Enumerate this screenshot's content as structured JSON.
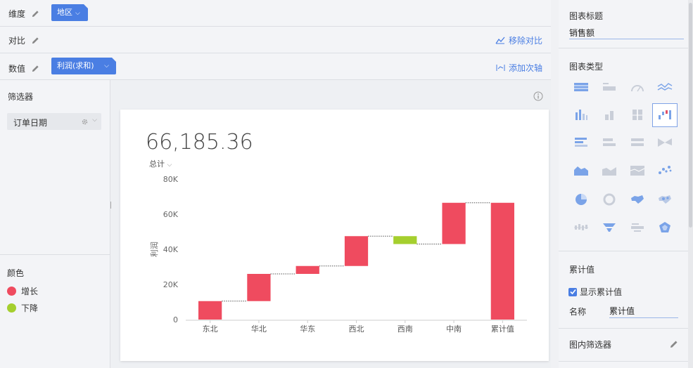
{
  "config": {
    "dimension_label": "维度",
    "dimension_pill": "地区",
    "compare_label": "对比",
    "remove_compare": "移除对比",
    "value_label": "数值",
    "value_pill": "利润(求和)",
    "add_secondary_axis": "添加次轴"
  },
  "filters": {
    "title": "筛选器",
    "items": [
      {
        "label": "订单日期"
      }
    ]
  },
  "color_legend": {
    "title": "颜色",
    "items": [
      {
        "label": "增长",
        "color": "#ef4b5f"
      },
      {
        "label": "下降",
        "color": "#a5cf2e"
      }
    ]
  },
  "kpi": {
    "value": "66,185.36",
    "label": "总计"
  },
  "chart_data": {
    "type": "bar",
    "subtype": "waterfall",
    "categories": [
      "东北",
      "华北",
      "华东",
      "西北",
      "西南",
      "中南",
      "累计值"
    ],
    "values": [
      10500,
      15500,
      4500,
      17000,
      -4500,
      23500,
      66500
    ],
    "ylabel": "利润",
    "ylim": [
      0,
      80000
    ],
    "yticks": [
      0,
      20000,
      40000,
      60000,
      80000
    ],
    "ytick_labels": [
      "0",
      "20K",
      "40K",
      "60K",
      "80K"
    ],
    "colors": {
      "increase": "#ef4b5f",
      "decrease": "#a5cf2e",
      "total": "#ef4b5f"
    }
  },
  "right_panel": {
    "chart_title_heading": "图表标题",
    "chart_title_value": "销售额",
    "chart_type_heading": "图表类型",
    "cumulative_heading": "累计值",
    "show_cumulative_label": "显示累计值",
    "show_cumulative_checked": true,
    "name_label": "名称",
    "name_value": "累计值",
    "inner_filter_label": "图内筛选器",
    "chart_types": [
      {
        "name": "table-chart-icon"
      },
      {
        "name": "kpi-number-icon"
      },
      {
        "name": "gauge-icon"
      },
      {
        "name": "line-chart-icon"
      },
      {
        "name": "column-chart-icon"
      },
      {
        "name": "stacked-column-icon"
      },
      {
        "name": "percent-column-icon"
      },
      {
        "name": "waterfall-chart-icon",
        "selected": true
      },
      {
        "name": "bar-chart-icon"
      },
      {
        "name": "stacked-bar-icon"
      },
      {
        "name": "percent-bar-icon"
      },
      {
        "name": "sankey-icon"
      },
      {
        "name": "area-chart-icon"
      },
      {
        "name": "stacked-area-icon"
      },
      {
        "name": "percent-area-icon"
      },
      {
        "name": "scatter-chart-icon"
      },
      {
        "name": "pie-chart-icon"
      },
      {
        "name": "donut-chart-icon"
      },
      {
        "name": "map-icon"
      },
      {
        "name": "bubble-map-icon"
      },
      {
        "name": "box-plot-icon"
      },
      {
        "name": "funnel-icon"
      },
      {
        "name": "word-cloud-icon"
      },
      {
        "name": "radar-icon"
      }
    ]
  }
}
